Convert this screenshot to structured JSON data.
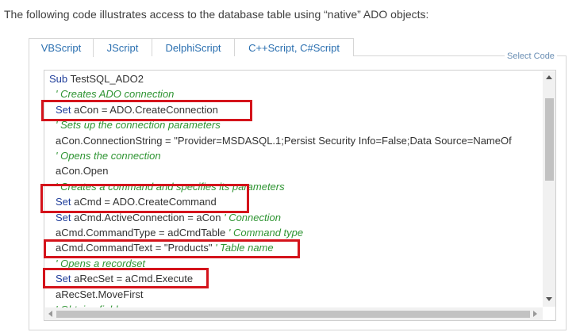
{
  "intro_text": "The following code illustrates access to the database table using “native” ADO objects:",
  "tabs": [
    {
      "label": "VBScript",
      "active": true
    },
    {
      "label": "JScript",
      "active": false
    },
    {
      "label": "DelphiScript",
      "active": false
    },
    {
      "label": "C++Script, C#Script",
      "active": false
    }
  ],
  "select_code_label": "Select Code",
  "code_lines": [
    {
      "segments": [
        {
          "text": "Sub",
          "kind": "kw"
        },
        {
          "text": " TestSQL_ADO2",
          "kind": "plain"
        }
      ]
    },
    {
      "segments": [
        {
          "text": "' Creates ADO connection",
          "kind": "cm"
        }
      ]
    },
    {
      "segments": [
        {
          "text": "Set",
          "kind": "kw"
        },
        {
          "text": " aCon = ADO.CreateConnection",
          "kind": "plain"
        }
      ]
    },
    {
      "segments": [
        {
          "text": "' Sets up the connection parameters",
          "kind": "cm"
        }
      ]
    },
    {
      "segments": [
        {
          "text": "aCon.ConnectionString = \"Provider=MSDASQL.1;Persist Security Info=False;Data Source=NameOf",
          "kind": "plain"
        }
      ]
    },
    {
      "segments": [
        {
          "text": "' Opens the connection",
          "kind": "cm"
        }
      ]
    },
    {
      "segments": [
        {
          "text": "aCon.Open",
          "kind": "plain"
        }
      ]
    },
    {
      "segments": [
        {
          "text": "' Creates a command and specifies its parameters",
          "kind": "cm"
        }
      ]
    },
    {
      "segments": [
        {
          "text": "Set",
          "kind": "kw"
        },
        {
          "text": " aCmd = ADO.CreateCommand",
          "kind": "plain"
        }
      ]
    },
    {
      "segments": [
        {
          "text": "Set",
          "kind": "kw"
        },
        {
          "text": " aCmd.ActiveConnection = aCon ",
          "kind": "plain"
        },
        {
          "text": "' Connection",
          "kind": "cm"
        }
      ]
    },
    {
      "segments": [
        {
          "text": "aCmd.CommandType = adCmdTable ",
          "kind": "plain"
        },
        {
          "text": "' Command type",
          "kind": "cm"
        }
      ]
    },
    {
      "segments": [
        {
          "text": "aCmd.CommandText = \"Products\" ",
          "kind": "plain"
        },
        {
          "text": "' Table name",
          "kind": "cm"
        }
      ]
    },
    {
      "segments": [
        {
          "text": "' Opens a recordset",
          "kind": "cm"
        }
      ]
    },
    {
      "segments": [
        {
          "text": "Set",
          "kind": "kw"
        },
        {
          "text": " aRecSet = aCmd.Execute",
          "kind": "plain"
        }
      ]
    },
    {
      "segments": [
        {
          "text": "aRecSet.MoveFirst",
          "kind": "plain"
        }
      ]
    },
    {
      "segments": [
        {
          "text": "' Obtains field names",
          "kind": "cm"
        }
      ]
    }
  ],
  "colors": {
    "keyword": "#1f3d9a",
    "comment": "#2e9432",
    "highlight_box": "#d4131b",
    "tab_text": "#2a6fb0"
  }
}
